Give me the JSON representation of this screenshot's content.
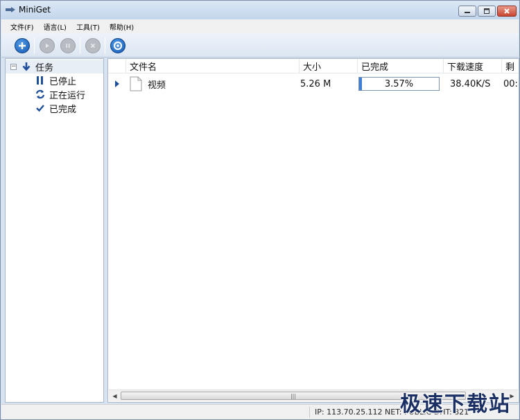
{
  "window": {
    "title": "MiniGet",
    "controls": [
      "minimize",
      "maximize",
      "close"
    ]
  },
  "menu": [
    "文件(F)",
    "语言(L)",
    "工具(T)",
    "帮助(H)"
  ],
  "toolbar": {
    "buttons": [
      {
        "name": "add",
        "icon": "plus-icon",
        "enabled": true
      },
      {
        "name": "start",
        "icon": "play-icon",
        "enabled": false
      },
      {
        "name": "pause",
        "icon": "pause-icon",
        "enabled": false
      },
      {
        "name": "delete",
        "icon": "x-icon",
        "enabled": false
      },
      {
        "name": "settings",
        "icon": "settings-icon",
        "enabled": true
      }
    ]
  },
  "tree": {
    "root": {
      "label": "任务",
      "icon": "arrow-down-icon",
      "expanded": true
    },
    "children": [
      {
        "label": "已停止",
        "icon": "pause-icon"
      },
      {
        "label": "正在运行",
        "icon": "refresh-icon"
      },
      {
        "label": "已完成",
        "icon": "check-icon"
      }
    ]
  },
  "list": {
    "columns": [
      "文件名",
      "大小",
      "已完成",
      "下载速度",
      "剩"
    ],
    "rows": [
      {
        "name": "视频",
        "size": "5.26 M",
        "progress": 0.0357,
        "progress_label": "3.57%",
        "speed": "38.40K/S",
        "remaining": "00:"
      }
    ]
  },
  "status": {
    "text": "IP: 113.70.25.112 NET: PUBLIC   DHT: 821"
  },
  "watermark": "极速下载站",
  "colors": {
    "accent": "#1557b0",
    "progress": "#3d7fd3",
    "window_frame": "#d7e3f1"
  }
}
